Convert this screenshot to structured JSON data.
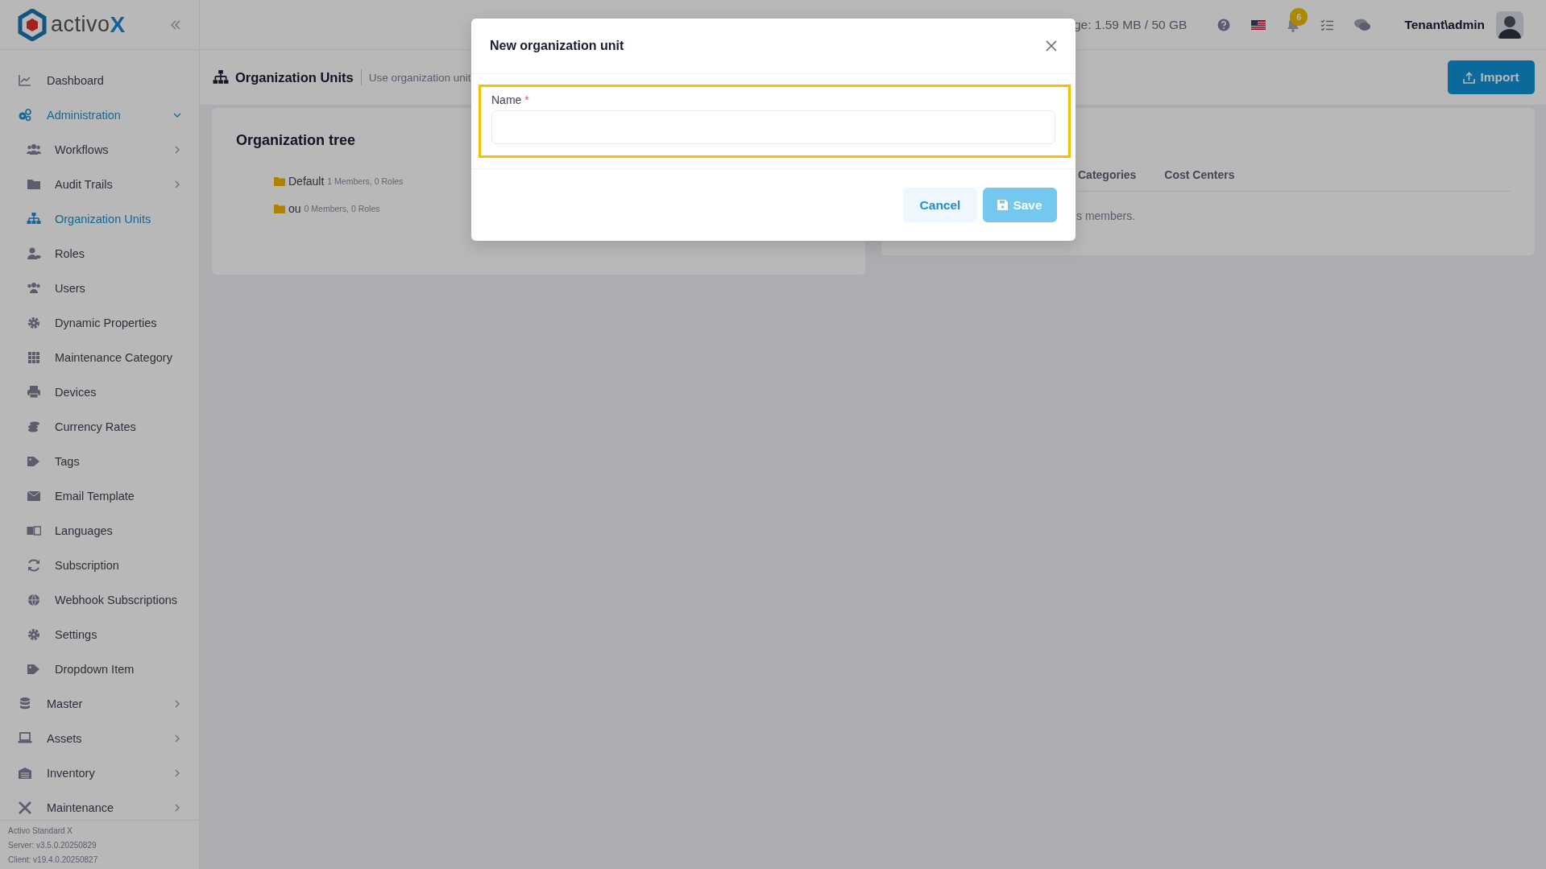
{
  "logo": {
    "text": "activo",
    "accent": "X"
  },
  "sidebar": {
    "items": [
      {
        "label": "Dashboard",
        "selected": false
      },
      {
        "label": "Administration",
        "selected": true,
        "expanded": true,
        "children": [
          {
            "label": "Workflows",
            "selected": false,
            "expanded": false
          },
          {
            "label": "Audit Trails",
            "selected": false,
            "expanded": false
          },
          {
            "label": "Organization Units",
            "selected": true
          },
          {
            "label": "Roles",
            "selected": false
          },
          {
            "label": "Users",
            "selected": false
          },
          {
            "label": "Dynamic Properties",
            "selected": false
          },
          {
            "label": "Maintenance Category",
            "selected": false
          },
          {
            "label": "Devices",
            "selected": false
          },
          {
            "label": "Currency Rates",
            "selected": false
          },
          {
            "label": "Tags",
            "selected": false
          },
          {
            "label": "Email Template",
            "selected": false
          },
          {
            "label": "Languages",
            "selected": false
          },
          {
            "label": "Subscription",
            "selected": false
          },
          {
            "label": "Webhook Subscriptions",
            "selected": false
          },
          {
            "label": "Settings",
            "selected": false
          },
          {
            "label": "Dropdown Item",
            "selected": false
          }
        ]
      },
      {
        "label": "Master",
        "selected": false,
        "expanded": false
      },
      {
        "label": "Assets",
        "selected": false,
        "expanded": false
      },
      {
        "label": "Inventory",
        "selected": false,
        "expanded": false
      },
      {
        "label": "Maintenance",
        "selected": false,
        "expanded": false
      }
    ],
    "footer": [
      "Activo Standard X",
      "Server: v3.5.0.20250829",
      "Client: v19.4.0.20250827"
    ]
  },
  "header": {
    "storage": "ge: 1.59 MB / 50 GB",
    "notification_count": "6",
    "user": "Tenant\\admin"
  },
  "page": {
    "title": "Organization Units",
    "subtitle": "Use organization unit",
    "import_button": "Import"
  },
  "org_tree": {
    "title": "Organization tree",
    "nodes": [
      {
        "label": "Default",
        "detail": "1 Members, 0 Roles"
      },
      {
        "label": "ou",
        "detail": "0 Members, 0 Roles"
      }
    ]
  },
  "details": {
    "tabs": [
      {
        "label": "Categories",
        "selected": false
      },
      {
        "label": "Cost Centers",
        "selected": false
      }
    ],
    "message": "s members."
  },
  "modal": {
    "title": "New organization unit",
    "field": {
      "label": "Name",
      "required_mark": "*",
      "highlighted": true
    },
    "buttons": {
      "cancel": "Cancel",
      "save": "Save",
      "save_disabled": true
    }
  }
}
